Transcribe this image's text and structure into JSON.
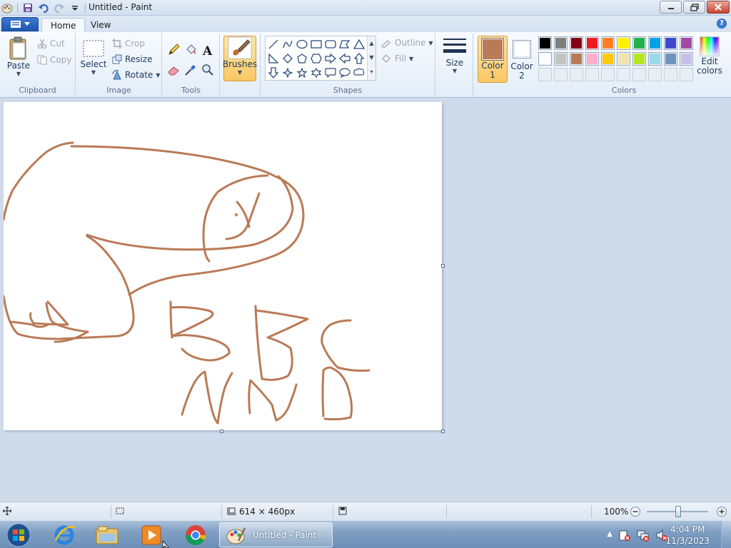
{
  "window": {
    "title": "Untitled - Paint",
    "qat_icons": [
      "paint-app-icon",
      "save-icon",
      "undo-icon",
      "redo-icon",
      "customize-qat-icon"
    ]
  },
  "tabs": {
    "home": "Home",
    "view": "View"
  },
  "ribbon": {
    "clipboard": {
      "label": "Clipboard",
      "paste": "Paste",
      "cut": "Cut",
      "copy": "Copy"
    },
    "image": {
      "label": "Image",
      "select": "Select",
      "crop": "Crop",
      "resize": "Resize",
      "rotate": "Rotate"
    },
    "tools": {
      "label": "Tools"
    },
    "brushes": {
      "label": "Brushes"
    },
    "shapes": {
      "label": "Shapes",
      "outline": "Outline",
      "fill": "Fill"
    },
    "size": {
      "label": "Size"
    },
    "colors": {
      "label": "Colors",
      "color1_line1": "Color",
      "color1_line2": "1",
      "color2_line1": "Color",
      "color2_line2": "2",
      "edit_line1": "Edit",
      "edit_line2": "colors",
      "color1_value": "#b97a57",
      "color2_value": "#ffffff",
      "palette_row1": [
        "#000000",
        "#7f7f7f",
        "#880015",
        "#ed1c24",
        "#ff7f27",
        "#fff200",
        "#22b14c",
        "#00a2e8",
        "#3f48cc",
        "#a349a4"
      ],
      "palette_row2": [
        "#ffffff",
        "#c3c3c3",
        "#b97a57",
        "#ffaec9",
        "#ffc90e",
        "#efe4b0",
        "#b5e61d",
        "#99d9ea",
        "#7092be",
        "#c8bfe7"
      ]
    }
  },
  "canvas": {
    "stroke_color": "#b97a57"
  },
  "statusbar": {
    "dimensions": "614 × 460px",
    "zoom": "100%"
  },
  "taskbar": {
    "active_window": "Untitled - Paint",
    "time": "4:04 PM",
    "date": "11/3/2023"
  }
}
